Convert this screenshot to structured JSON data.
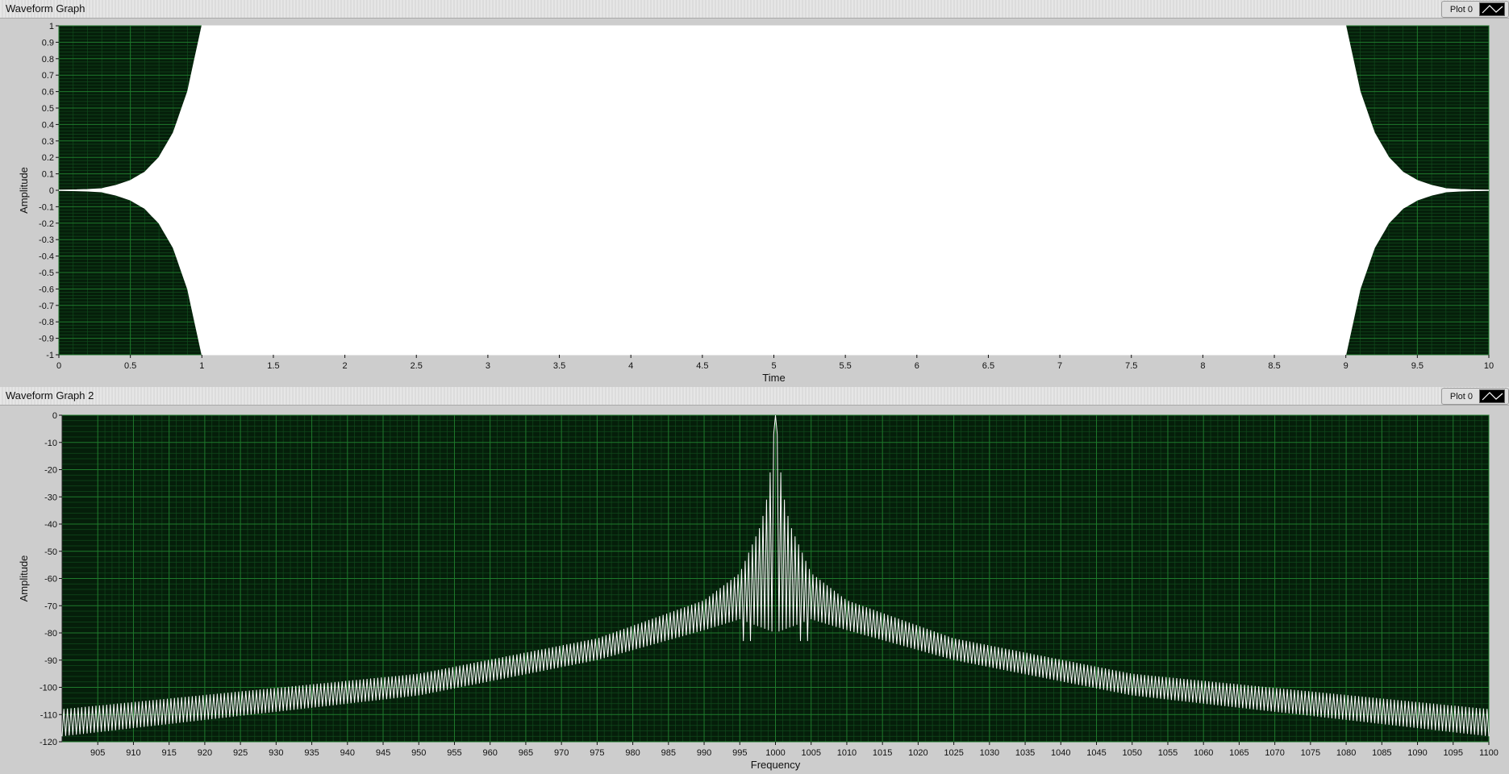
{
  "graphs": [
    {
      "title": "Waveform Graph",
      "legend_label": "Plot 0",
      "chart_data": {
        "type": "line",
        "title": "Waveform Graph",
        "xlabel": "Time",
        "ylabel": "Amplitude",
        "xlim": [
          0,
          10
        ],
        "ylim": [
          -1,
          1
        ],
        "x_ticks": [
          "0",
          "0.5",
          "1",
          "1.5",
          "2",
          "2.5",
          "3",
          "3.5",
          "4",
          "4.5",
          "5",
          "5.5",
          "6",
          "6.5",
          "7",
          "7.5",
          "8",
          "8.5",
          "9",
          "9.5",
          "10"
        ],
        "y_ticks": [
          "1",
          "0.9",
          "0.8",
          "0.7",
          "0.6",
          "0.5",
          "0.4",
          "0.3",
          "0.2",
          "0.1",
          "0",
          "-0.1",
          "-0.2",
          "-0.3",
          "-0.4",
          "-0.5",
          "-0.6",
          "-0.7",
          "-0.8",
          "-0.9",
          "-1"
        ],
        "grid": true,
        "series": [
          {
            "name": "Plot 0",
            "description": "dense oscillation; envelope ±1 between 1 and 9, tapering to 0 at 0 and 10",
            "envelope_x": [
              0,
              0.2,
              0.3,
              0.4,
              0.5,
              0.6,
              0.7,
              0.8,
              0.9,
              1.0,
              9.0,
              9.1,
              9.2,
              9.3,
              9.4,
              9.5,
              9.6,
              9.7,
              9.8,
              10
            ],
            "envelope_y": [
              0,
              0.005,
              0.01,
              0.03,
              0.06,
              0.11,
              0.2,
              0.35,
              0.6,
              1.0,
              1.0,
              0.6,
              0.35,
              0.2,
              0.11,
              0.06,
              0.03,
              0.01,
              0.005,
              0
            ]
          }
        ]
      }
    },
    {
      "title": "Waveform Graph 2",
      "legend_label": "Plot 0",
      "chart_data": {
        "type": "line",
        "title": "Waveform Graph 2",
        "xlabel": "Frequency",
        "ylabel": "Amplitude",
        "xlim": [
          900,
          1100
        ],
        "ylim": [
          -120,
          0
        ],
        "x_ticks": [
          "905",
          "910",
          "915",
          "920",
          "925",
          "930",
          "935",
          "940",
          "945",
          "950",
          "955",
          "960",
          "965",
          "970",
          "975",
          "980",
          "985",
          "990",
          "995",
          "1000",
          "1005",
          "1010",
          "1015",
          "1020",
          "1025",
          "1030",
          "1035",
          "1040",
          "1045",
          "1050",
          "1055",
          "1060",
          "1065",
          "1070",
          "1075",
          "1080",
          "1085",
          "1090",
          "1095",
          "1100"
        ],
        "y_ticks": [
          "0",
          "-10",
          "-20",
          "-30",
          "-40",
          "-50",
          "-60",
          "-70",
          "-80",
          "-90",
          "-100",
          "-110",
          "-120"
        ],
        "grid": true,
        "series": [
          {
            "name": "Plot 0",
            "description": "spectrum peak at 1000 (0), side-lobe band decaying toward the edges",
            "peak_x": 1000,
            "peak_y": 0,
            "upper_x": [
              900,
              950,
              975,
              990,
              995,
              998,
              999,
              1000,
              1001,
              1002,
              1005,
              1010,
              1025,
              1050,
              1100
            ],
            "upper_y": [
              -108,
              -95,
              -82,
              -68,
              -58,
              -40,
              -28,
              0,
              -28,
              -40,
              -58,
              -68,
              -82,
              -95,
              -108
            ],
            "lower_x": [
              900,
              950,
              975,
              990,
              995,
              1000,
              1005,
              1010,
              1025,
              1050,
              1100
            ],
            "lower_y": [
              -118,
              -103,
              -90,
              -79,
              -75,
              -80,
              -75,
              -79,
              -90,
              -103,
              -118
            ],
            "notch_y": -83
          }
        ]
      }
    }
  ]
}
